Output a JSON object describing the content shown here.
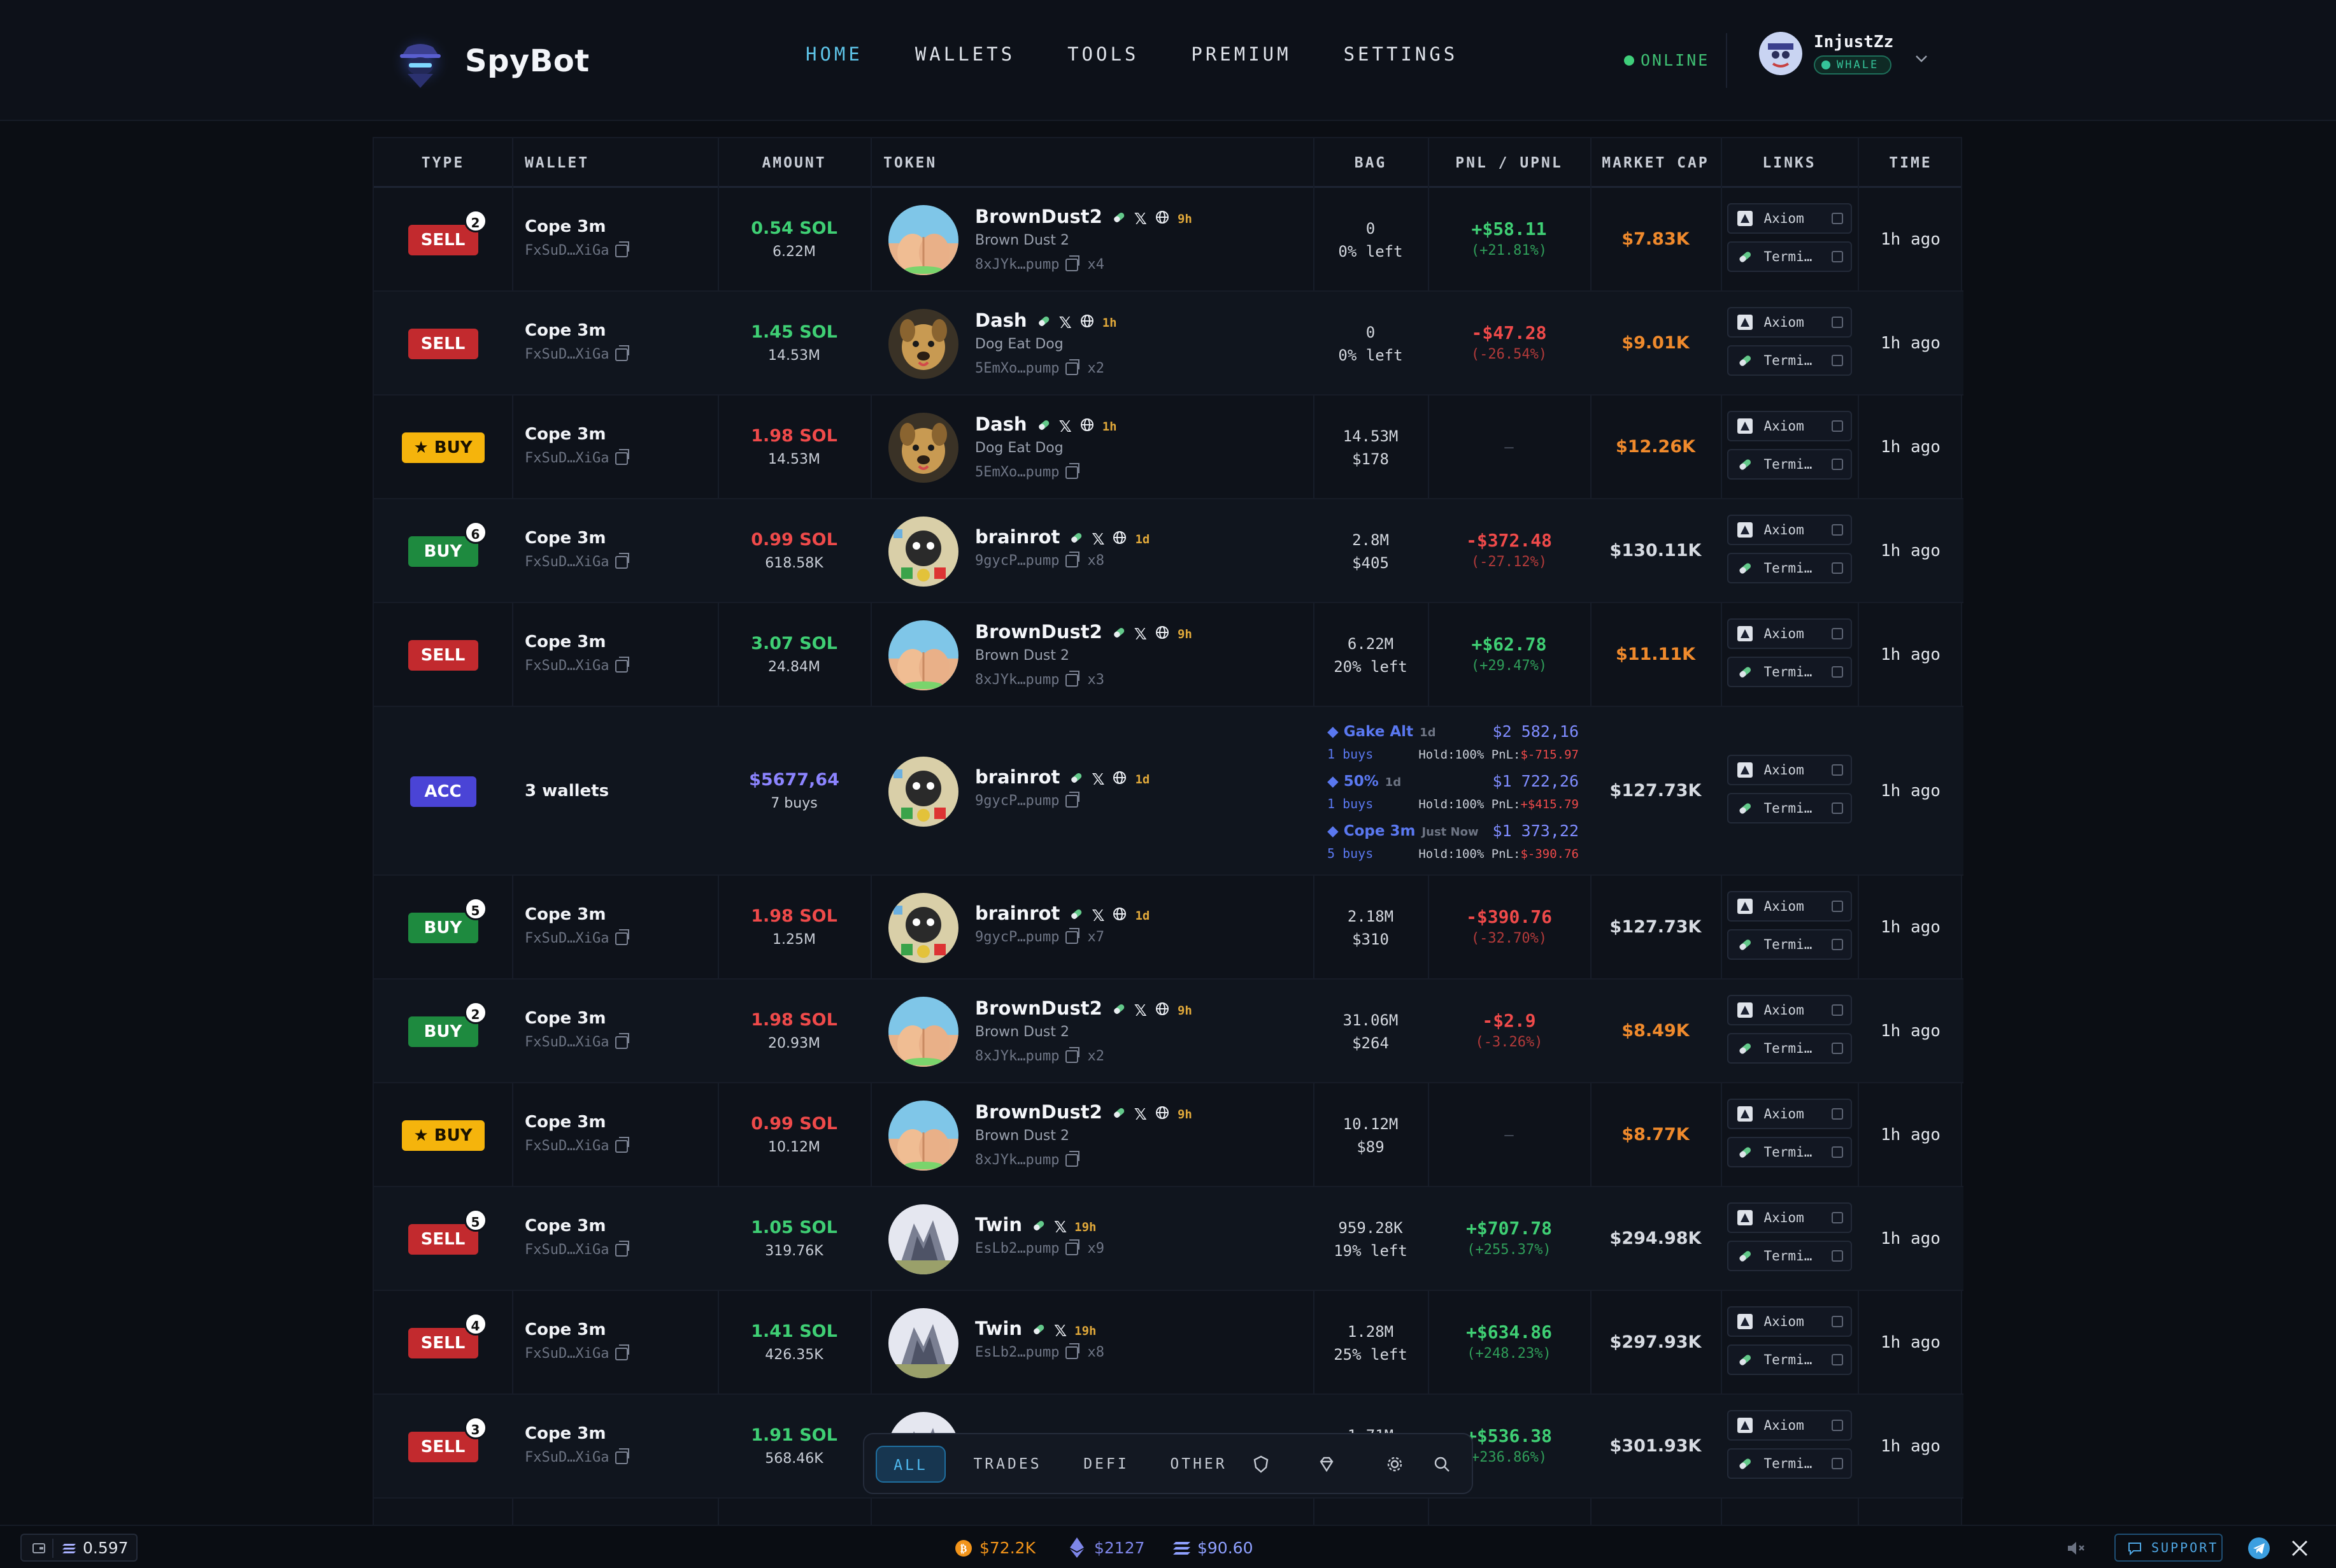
{
  "app": {
    "name": "SpyBot"
  },
  "nav": {
    "items": [
      "HOME",
      "WALLETS",
      "TOOLS",
      "PREMIUM",
      "SETTINGS"
    ],
    "active": "HOME"
  },
  "status": "ONLINE",
  "user": {
    "name": "InjustZz",
    "badge": "WHALE"
  },
  "columns": [
    "TYPE",
    "WALLET",
    "AMOUNT",
    "TOKEN",
    "BAG",
    "PNL / UPNL",
    "MARKET CAP",
    "LINKS",
    "TIME"
  ],
  "links": {
    "axiom": "Axiom",
    "terminal": "Termi…"
  },
  "rows": [
    {
      "type": "SELL",
      "count": "2",
      "wallet": "Cope 3m",
      "addr": "FxSuD…XiGa",
      "amount": "0.54 SOL",
      "amountColor": "green",
      "amount2": "6.22M",
      "token": "BrownDust2",
      "tokenAge": "9h",
      "tokenSub": "Brown Dust 2",
      "tokenAddr": "8xJYk…pump",
      "tokenMult": "x4",
      "bag1": "0",
      "bag2": "0% left",
      "pnl": "+$58.11",
      "pnlPct": "(+21.81%)",
      "pnlSign": "pos",
      "mcap": "$7.83K",
      "mcapColor": "orange",
      "time": "1h ago",
      "img": "dust",
      "web": true
    },
    {
      "type": "SELL",
      "count": "",
      "wallet": "Cope 3m",
      "addr": "FxSuD…XiGa",
      "amount": "1.45 SOL",
      "amountColor": "green",
      "amount2": "14.53M",
      "token": "Dash",
      "tokenAge": "1h",
      "tokenSub": "Dog Eat Dog",
      "tokenAddr": "5EmXo…pump",
      "tokenMult": "x2",
      "bag1": "0",
      "bag2": "0% left",
      "pnl": "-$47.28",
      "pnlPct": "(-26.54%)",
      "pnlSign": "neg",
      "mcap": "$9.01K",
      "mcapColor": "orange",
      "time": "1h ago",
      "img": "dog",
      "web": true
    },
    {
      "type": "STARBUY",
      "count": "",
      "wallet": "Cope 3m",
      "addr": "FxSuD…XiGa",
      "amount": "1.98 SOL",
      "amountColor": "red",
      "amount2": "14.53M",
      "token": "Dash",
      "tokenAge": "1h",
      "tokenSub": "Dog Eat Dog",
      "tokenAddr": "5EmXo…pump",
      "tokenMult": "",
      "bag1": "14.53M",
      "bag2": "$178",
      "pnl": "",
      "pnlPct": "",
      "pnlSign": "none",
      "mcap": "$12.26K",
      "mcapColor": "orange",
      "time": "1h ago",
      "img": "dog",
      "web": true
    },
    {
      "type": "BUY",
      "count": "6",
      "wallet": "Cope 3m",
      "addr": "FxSuD…XiGa",
      "amount": "0.99 SOL",
      "amountColor": "red",
      "amount2": "618.58K",
      "token": "brainrot",
      "tokenAge": "1d",
      "tokenSub": "",
      "tokenAddr": "9gycP…pump",
      "tokenMult": "x8",
      "bag1": "2.8M",
      "bag2": "$405",
      "pnl": "-$372.48",
      "pnlPct": "(-27.12%)",
      "pnlSign": "neg",
      "mcap": "$130.11K",
      "mcapColor": "grey",
      "time": "1h ago",
      "img": "brain",
      "web": true
    },
    {
      "type": "SELL",
      "count": "",
      "wallet": "Cope 3m",
      "addr": "FxSuD…XiGa",
      "amount": "3.07 SOL",
      "amountColor": "green",
      "amount2": "24.84M",
      "token": "BrownDust2",
      "tokenAge": "9h",
      "tokenSub": "Brown Dust 2",
      "tokenAddr": "8xJYk…pump",
      "tokenMult": "x3",
      "bag1": "6.22M",
      "bag2": "20% left",
      "pnl": "+$62.78",
      "pnlPct": "(+29.47%)",
      "pnlSign": "pos",
      "mcap": "$11.11K",
      "mcapColor": "orange",
      "time": "1h ago",
      "img": "dust",
      "web": true
    },
    {
      "type": "ACC",
      "count": "",
      "wallet": "3 wallets",
      "addr": "",
      "amount": "$5677,64",
      "amountColor": "blue",
      "amount2": "7 buys",
      "token": "brainrot",
      "tokenAge": "1d",
      "tokenSub": "",
      "tokenAddr": "9gycP…pump",
      "tokenMult": "",
      "bag1": "",
      "bag2": "",
      "pnl": "",
      "pnlPct": "",
      "pnlSign": "acc",
      "mcap": "$127.73K",
      "mcapColor": "grey",
      "time": "1h ago",
      "img": "brain",
      "web": true,
      "acc": [
        {
          "name": "Gake Alt",
          "age": "1d",
          "val": "$2 582,16",
          "buys": "1 buys",
          "hold": "Hold:100% PnL:",
          "pnl": "$-715.97"
        },
        {
          "name": "50%",
          "age": "1d",
          "val": "$1 722,26",
          "buys": "1 buys",
          "hold": "Hold:100% PnL:",
          "pnl": "+$415.79"
        },
        {
          "name": "Cope 3m",
          "age": "Just Now",
          "val": "$1 373,22",
          "buys": "5 buys",
          "hold": "Hold:100% PnL:",
          "pnl": "$-390.76"
        }
      ]
    },
    {
      "type": "BUY",
      "count": "5",
      "wallet": "Cope 3m",
      "addr": "FxSuD…XiGa",
      "amount": "1.98 SOL",
      "amountColor": "red",
      "amount2": "1.25M",
      "token": "brainrot",
      "tokenAge": "1d",
      "tokenSub": "",
      "tokenAddr": "9gycP…pump",
      "tokenMult": "x7",
      "bag1": "2.18M",
      "bag2": "$310",
      "pnl": "-$390.76",
      "pnlPct": "(-32.70%)",
      "pnlSign": "neg",
      "mcap": "$127.73K",
      "mcapColor": "grey",
      "time": "1h ago",
      "img": "brain",
      "web": true
    },
    {
      "type": "BUY",
      "count": "2",
      "wallet": "Cope 3m",
      "addr": "FxSuD…XiGa",
      "amount": "1.98 SOL",
      "amountColor": "red",
      "amount2": "20.93M",
      "token": "BrownDust2",
      "tokenAge": "9h",
      "tokenSub": "Brown Dust 2",
      "tokenAddr": "8xJYk…pump",
      "tokenMult": "x2",
      "bag1": "31.06M",
      "bag2": "$264",
      "pnl": "-$2.9",
      "pnlPct": "(-3.26%)",
      "pnlSign": "neg",
      "mcap": "$8.49K",
      "mcapColor": "orange",
      "time": "1h ago",
      "img": "dust",
      "web": true
    },
    {
      "type": "STARBUY",
      "count": "",
      "wallet": "Cope 3m",
      "addr": "FxSuD…XiGa",
      "amount": "0.99 SOL",
      "amountColor": "red",
      "amount2": "10.12M",
      "token": "BrownDust2",
      "tokenAge": "9h",
      "tokenSub": "Brown Dust 2",
      "tokenAddr": "8xJYk…pump",
      "tokenMult": "",
      "bag1": "10.12M",
      "bag2": "$89",
      "pnl": "",
      "pnlPct": "",
      "pnlSign": "none",
      "mcap": "$8.77K",
      "mcapColor": "orange",
      "time": "1h ago",
      "img": "dust",
      "web": true
    },
    {
      "type": "SELL",
      "count": "5",
      "wallet": "Cope 3m",
      "addr": "FxSuD…XiGa",
      "amount": "1.05 SOL",
      "amountColor": "green",
      "amount2": "319.76K",
      "token": "Twin",
      "tokenAge": "19h",
      "tokenSub": "",
      "tokenAddr": "EsLb2…pump",
      "tokenMult": "x9",
      "bag1": "959.28K",
      "bag2": "19% left",
      "pnl": "+$707.78",
      "pnlPct": "(+255.37%)",
      "pnlSign": "pos",
      "mcap": "$294.98K",
      "mcapColor": "grey",
      "time": "1h ago",
      "img": "twin",
      "web": false
    },
    {
      "type": "SELL",
      "count": "4",
      "wallet": "Cope 3m",
      "addr": "FxSuD…XiGa",
      "amount": "1.41 SOL",
      "amountColor": "green",
      "amount2": "426.35K",
      "token": "Twin",
      "tokenAge": "19h",
      "tokenSub": "",
      "tokenAddr": "EsLb2…pump",
      "tokenMult": "x8",
      "bag1": "1.28M",
      "bag2": "25% left",
      "pnl": "+$634.86",
      "pnlPct": "(+248.23%)",
      "pnlSign": "pos",
      "mcap": "$297.93K",
      "mcapColor": "grey",
      "time": "1h ago",
      "img": "twin",
      "web": false
    },
    {
      "type": "SELL",
      "count": "3",
      "wallet": "Cope 3m",
      "addr": "FxSuD…XiGa",
      "amount": "1.91 SOL",
      "amountColor": "green",
      "amount2": "568.46K",
      "token": "Twin",
      "tokenAge": "19h",
      "tokenSub": "",
      "tokenAddr": "",
      "tokenMult": "",
      "bag1": "1.71M",
      "bag2": "",
      "pnl": "+$536.38",
      "pnlPct": "+236.86%)",
      "pnlSign": "pos",
      "mcap": "$301.93K",
      "mcapColor": "grey",
      "time": "1h ago",
      "img": "twin",
      "web": false
    }
  ],
  "filter": {
    "items": [
      "ALL",
      "TRADES",
      "DEFI",
      "OTHER"
    ],
    "active": "ALL"
  },
  "footer": {
    "balance": "0.597",
    "btc": "$72.2K",
    "eth": "$2127",
    "sol": "$90.60",
    "support": "SUPPORT"
  }
}
